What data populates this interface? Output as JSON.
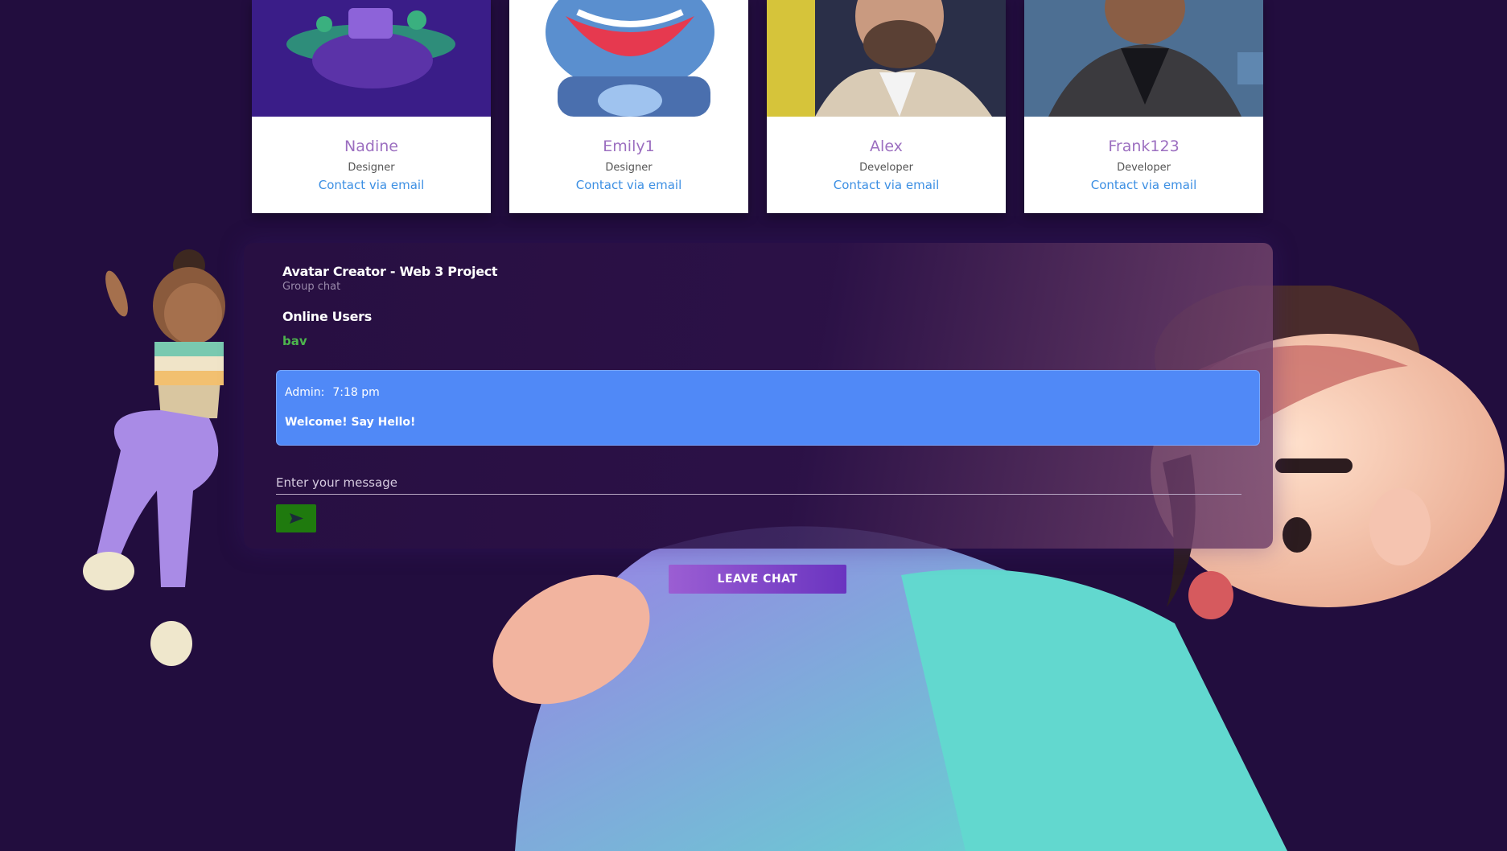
{
  "team": [
    {
      "name": "Nadine",
      "role": "Designer",
      "contact": "Contact via email"
    },
    {
      "name": "Emily1",
      "role": "Designer",
      "contact": "Contact via email"
    },
    {
      "name": "Alex",
      "role": "Developer",
      "contact": "Contact via email"
    },
    {
      "name": "Frank123",
      "role": "Developer",
      "contact": "Contact via email"
    }
  ],
  "chat": {
    "title": "Avatar Creator - Web 3 Project",
    "subtitle": "Group chat",
    "online_title": "Online Users",
    "online_users": [
      "bav"
    ],
    "messages": [
      {
        "author": "Admin:",
        "time": "7:18 pm",
        "text": "Welcome! Say Hello!"
      }
    ],
    "input_placeholder": "Enter your message",
    "send_icon": "send-icon",
    "leave_label": "LEAVE CHAT"
  },
  "colors": {
    "background": "#220d3e",
    "accent_purple": "#9c6fc0",
    "link_blue": "#3c8fe3",
    "message_blue": "#5089f7",
    "online_green": "#4db54d",
    "send_green": "#1f7a0e"
  }
}
